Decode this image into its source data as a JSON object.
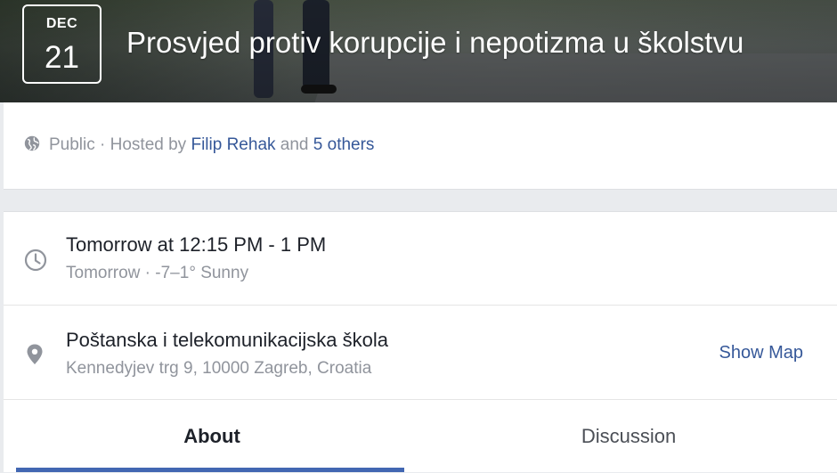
{
  "event": {
    "month": "DEC",
    "day": "21",
    "title": "Prosvjed protiv korupcije i nepotizma u školstvu"
  },
  "host": {
    "privacy": "Public",
    "hosted_by_prefix": "· Hosted by",
    "host_name": "Filip Rehak",
    "connector": "and",
    "others_link": "5 others"
  },
  "details": {
    "time_primary": "Tomorrow at 12:15 PM - 1 PM",
    "time_secondary": "Tomorrow · -7–1° Sunny",
    "place_name": "Poštanska i telekomunikacijska škola",
    "place_address": "Kennedyjev trg 9, 10000 Zagreb, Croatia",
    "show_map_label": "Show Map"
  },
  "tabs": [
    {
      "label": "About",
      "active": true
    },
    {
      "label": "Discussion",
      "active": false
    }
  ],
  "colors": {
    "link": "#365899",
    "active_tab_underline": "#4267b2",
    "muted_text": "#90949c"
  },
  "icons": {
    "privacy": "globe-icon",
    "time": "clock-icon",
    "location": "location-pin-icon"
  }
}
